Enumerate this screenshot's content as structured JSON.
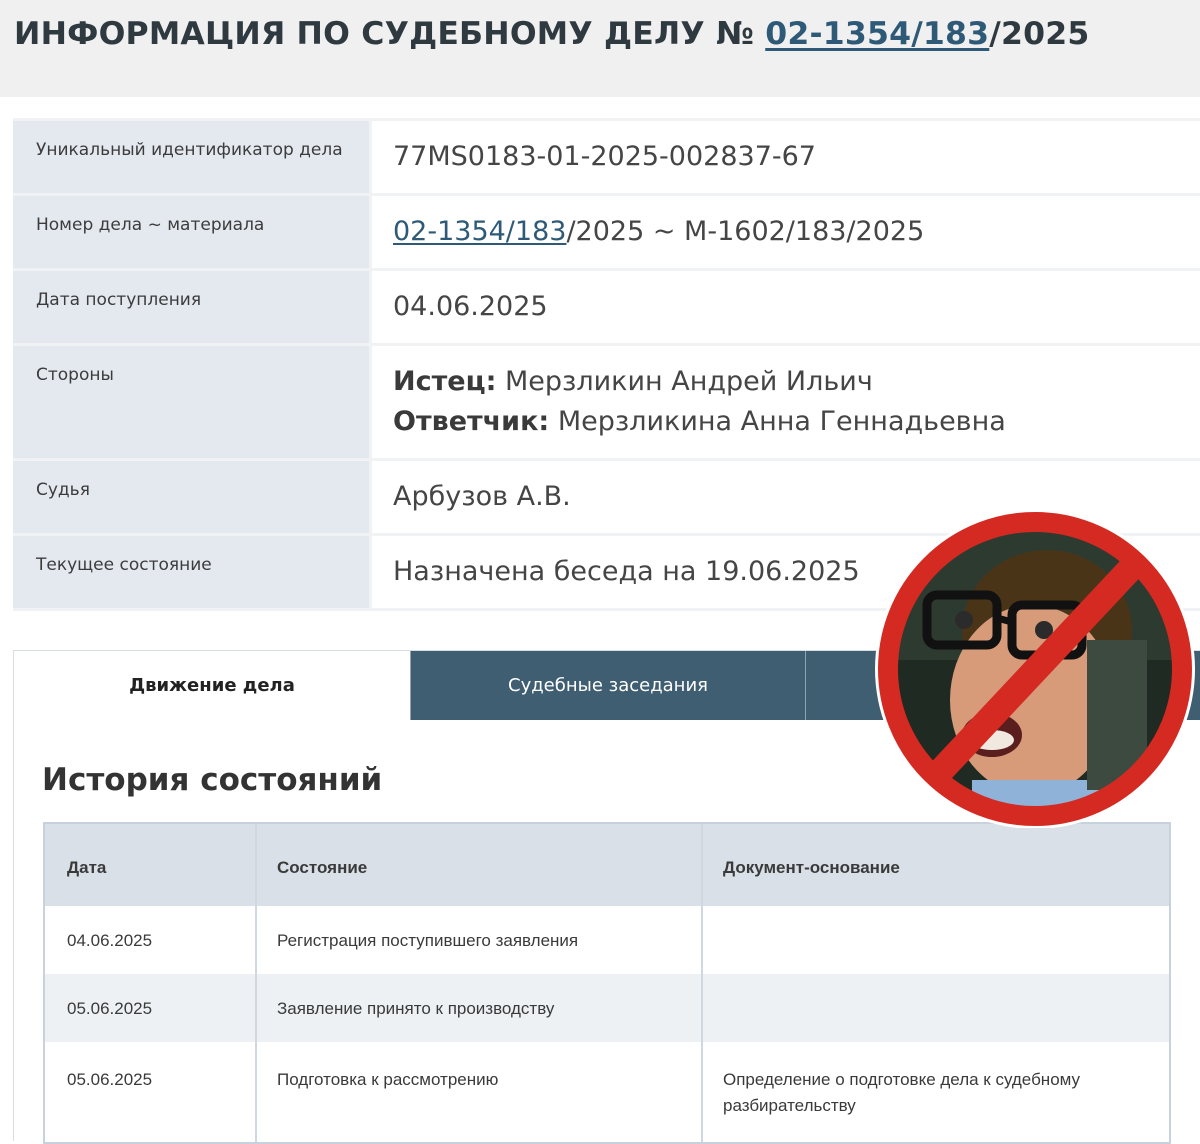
{
  "header": {
    "title_prefix": "ИНФОРМАЦИЯ ПО СУДЕБНОМУ ДЕЛУ № ",
    "case_link": "02-1354/183",
    "case_suffix": "/2025"
  },
  "info": {
    "uid_label": "Уникальный идентификатор дела",
    "uid_value": "77MS0183-01-2025-002837-67",
    "number_label": "Номер дела ~ материала",
    "number_link": "02-1354/183",
    "number_rest": "/2025 ~ М-1602/183/2025",
    "date_label": "Дата поступления",
    "date_value": "04.06.2025",
    "parties_label": "Стороны",
    "plaintiff_label": "Истец:",
    "plaintiff_value": " Мерзликин Андрей Ильич",
    "defendant_label": "Ответчик:",
    "defendant_value": " Мерзликина Анна Геннадьевна",
    "judge_label": "Судья",
    "judge_value": "Арбузов А.В.",
    "status_label": "Текущее состояние",
    "status_value": "Назначена беседа на 19.06.2025"
  },
  "tabs": [
    {
      "label": "Движение дела"
    },
    {
      "label": "Судебные заседания"
    },
    {
      "label": ""
    }
  ],
  "history": {
    "title": "История состояний",
    "headers": [
      "Дата",
      "Состояние",
      "Документ-основание"
    ],
    "rows": [
      [
        "04.06.2025",
        "Регистрация поступившего заявления",
        ""
      ],
      [
        "05.06.2025",
        "Заявление принято к производству",
        ""
      ],
      [
        "05.06.2025",
        "Подготовка к рассмотрению",
        "Определение о подготовке дела к судебному разбирательству"
      ]
    ]
  },
  "colors": {
    "accent_link": "#2e5a78",
    "tab_dark": "#3f5e71",
    "label_bg": "#e4e9f0",
    "ban_red": "#d42a22"
  },
  "icons": {
    "overlay": "prohibition-sign-over-portrait"
  }
}
